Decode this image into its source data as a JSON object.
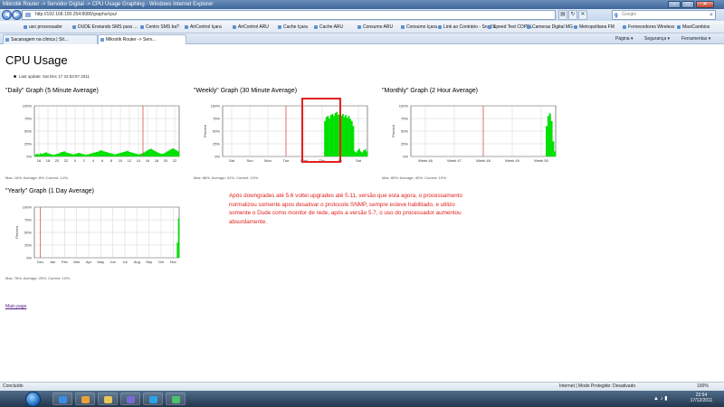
{
  "window": {
    "title": "Mikrotik Router -> Servidor Digital -> CPU Usage Graphing - Windows Internet Explorer",
    "url": "http://192.168.100.254:8080/graphs/cpu/",
    "search_placeholder": "Google"
  },
  "favorites": [
    "uso processador",
    "DUDE Enviando SMS para ...",
    "Centro SMS ba?",
    "AirControl Içara",
    "AirControl ARU",
    "Cache Içara",
    "Cache ARU",
    "Consumo ARU",
    "Consumo Içara",
    "Link ao Contrário - Snail's",
    "Speed Test COPEL",
    "Cameras Digital MG",
    "Metropolitana FM",
    "Fornecedores Wireless",
    "MaxiCambios"
  ],
  "tabs": [
    {
      "label": "Sacanagem na clinica | Sit..."
    },
    {
      "label": "Mikrotik Router -> Serv..."
    }
  ],
  "commands": [
    "Página",
    "Segurança",
    "Ferramentas"
  ],
  "page": {
    "title": "CPU Usage",
    "last_update": "Last update: Sat Dec 17 22:53:57 2011",
    "annotation": "Após downgrades até 5.6 voltei upgrades até 5.11, versão que esta agora, o processamento normalizou somente apos desativar o protocolo SNMP, sempre esteve habilitado, e utilizo somente o Dude como monitor de rede, após a versão 5.7, o uso do processador aumentou absurdamente.",
    "main_link": "Main page"
  },
  "graphs": [
    {
      "title": "\"Daily\" Graph (5 Minute Average)",
      "stats": "Max: 16%; Average: 8%; Current: 14%;",
      "y_ticks": [
        "100%",
        "75%",
        "50%",
        "25%",
        "0%"
      ],
      "x_ticks": [
        "16",
        "18",
        "20",
        "22",
        "0",
        "2",
        "4",
        "6",
        "8",
        "10",
        "12",
        "14",
        "16",
        "18",
        "20",
        "22"
      ],
      "y_label": "",
      "series": [
        4,
        5,
        4,
        6,
        5,
        7,
        8,
        6,
        5,
        4,
        3,
        4,
        5,
        6,
        8,
        9,
        10,
        8,
        7,
        6,
        5,
        4,
        5,
        6,
        7,
        6,
        5,
        4,
        3,
        4,
        5,
        6,
        7,
        8,
        9,
        10,
        12,
        11,
        10,
        9,
        8,
        7,
        6,
        5,
        4,
        5,
        6,
        7,
        8,
        9,
        10,
        11,
        9,
        8,
        7,
        6,
        5,
        4,
        5,
        6,
        8,
        10,
        12,
        14,
        15,
        13,
        11,
        9,
        7,
        6,
        5,
        6,
        8,
        10,
        12,
        14,
        16,
        14,
        12,
        10
      ],
      "now_index": 12
    },
    {
      "title": "\"Weekly\" Graph (30 Minute Average)",
      "stats": "Max: 88%; Average: 41%; Current: 10%;",
      "y_ticks": [
        "100%",
        "75%",
        "50%",
        "25%",
        "0%"
      ],
      "x_ticks": [
        "Sat",
        "Sun",
        "Mon",
        "Tue",
        "Wed",
        "Thu",
        "Fri",
        "Sat"
      ],
      "y_label": "Percent",
      "series": [
        0,
        0,
        0,
        0,
        0,
        0,
        0,
        0,
        0,
        0,
        0,
        0,
        0,
        0,
        0,
        0,
        0,
        0,
        0,
        0,
        0,
        0,
        0,
        0,
        0,
        0,
        0,
        0,
        0,
        0,
        0,
        0,
        0,
        0,
        0,
        0,
        0,
        0,
        0,
        0,
        0,
        0,
        0,
        0,
        0,
        0,
        0,
        0,
        0,
        0,
        0,
        0,
        0,
        0,
        0,
        0,
        0,
        0,
        0,
        0,
        0,
        0,
        0,
        0,
        0,
        0,
        0,
        0,
        70,
        78,
        80,
        75,
        82,
        84,
        80,
        86,
        88,
        82,
        85,
        80,
        84,
        78,
        82,
        76,
        80,
        74,
        70,
        60,
        10,
        8,
        12,
        15,
        10,
        8,
        12,
        14,
        10
      ],
      "now_index": 3
    },
    {
      "title": "\"Monthly\" Graph (2 Hour Average)",
      "stats": "Max: 85%; Average: 40%; Current: 10%;",
      "y_ticks": [
        "100%",
        "75%",
        "50%",
        "25%",
        "0%"
      ],
      "x_ticks": [
        "Week 46",
        "Week 47",
        "Week 48",
        "Week 49",
        "Week 50"
      ],
      "y_label": "Percent",
      "series": [
        0,
        0,
        0,
        0,
        0,
        0,
        0,
        0,
        0,
        0,
        0,
        0,
        0,
        0,
        0,
        0,
        0,
        0,
        0,
        0,
        0,
        0,
        0,
        0,
        0,
        0,
        0,
        0,
        0,
        0,
        0,
        0,
        0,
        0,
        0,
        0,
        0,
        0,
        0,
        0,
        0,
        0,
        0,
        0,
        0,
        0,
        0,
        0,
        0,
        0,
        0,
        0,
        0,
        0,
        0,
        0,
        0,
        0,
        0,
        0,
        0,
        0,
        0,
        0,
        0,
        0,
        0,
        0,
        0,
        0,
        0,
        0,
        0,
        0,
        0,
        0,
        0,
        0,
        0,
        0,
        0,
        0,
        60,
        80,
        85,
        70,
        30,
        10
      ],
      "now_index": 2
    },
    {
      "title": "\"Yearly\" Graph (1 Day Average)",
      "stats": "Max: 78%; Average: 25%; Current: 10%;",
      "y_ticks": [
        "100%",
        "75%",
        "50%",
        "25%",
        "0%"
      ],
      "x_ticks": [
        "Dec",
        "Jan",
        "Feb",
        "Mar",
        "Apr",
        "May",
        "Jun",
        "Jul",
        "Aug",
        "Sep",
        "Oct",
        "Nov"
      ],
      "y_label": "Percent",
      "series": [
        0,
        0,
        0,
        0,
        0,
        0,
        0,
        0,
        0,
        0,
        0,
        0,
        0,
        0,
        0,
        0,
        0,
        0,
        0,
        0,
        0,
        0,
        0,
        0,
        0,
        0,
        0,
        0,
        0,
        0,
        0,
        0,
        0,
        0,
        0,
        0,
        0,
        0,
        0,
        0,
        0,
        0,
        0,
        0,
        0,
        0,
        0,
        0,
        0,
        0,
        0,
        0,
        0,
        0,
        0,
        0,
        0,
        0,
        0,
        0,
        0,
        0,
        0,
        0,
        0,
        0,
        0,
        0,
        0,
        0,
        0,
        0,
        0,
        0,
        0,
        0,
        0,
        0,
        0,
        0,
        0,
        0,
        0,
        0,
        0,
        0,
        0,
        0,
        0,
        0,
        0,
        0,
        0,
        0,
        0,
        0,
        0,
        0,
        0,
        0,
        0,
        0,
        0,
        0,
        0,
        0,
        0,
        0,
        0,
        0,
        0,
        0,
        0,
        0,
        0,
        0,
        30,
        78
      ],
      "now_index": 0
    }
  ],
  "status": {
    "left": "Concluído",
    "right": "Internet | Modo Protegido: Desativado",
    "zoom": "100%"
  },
  "clock": {
    "time": "22:54",
    "date": "17/12/2011"
  },
  "colors": {
    "series": "#00e000",
    "now_marker": "#e05050",
    "grid": "#c8c8c8"
  }
}
